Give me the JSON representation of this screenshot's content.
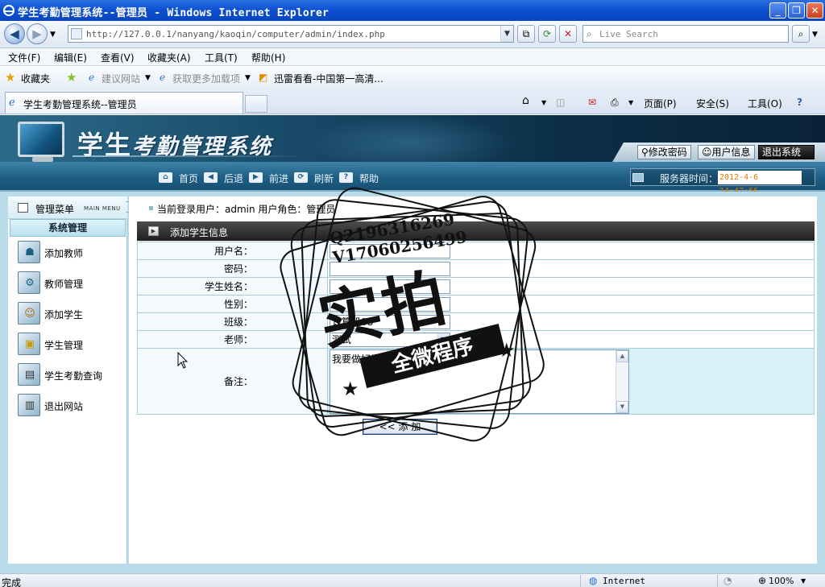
{
  "browser": {
    "window_title": "学生考勤管理系统--管理员 - Windows Internet Explorer",
    "url": "http://127.0.0.1/nanyang/kaoqin/computer/admin/index.php",
    "search_placeholder": "Live Search",
    "menu": [
      "文件(F)",
      "编辑(E)",
      "查看(V)",
      "收藏夹(A)",
      "工具(T)",
      "帮助(H)"
    ],
    "favorites": {
      "label": "收藏夹",
      "links": [
        "建议网站",
        "获取更多加载项",
        "迅雷看看-中国第一高清..."
      ]
    },
    "tab_title": "学生考勤管理系统--管理员",
    "commands": [
      "页面(P)",
      "安全(S)",
      "工具(O)"
    ],
    "status_text": "完成",
    "zone": "Internet",
    "zoom": "100%"
  },
  "app": {
    "title_part1": "学生",
    "title_part2": "考勤管理系统",
    "top_buttons": [
      "修改密码",
      "用户信息",
      "退出系统"
    ],
    "nav": [
      "首页",
      "后退",
      "前进",
      "刷新",
      "帮助"
    ],
    "server_time_label": "服务器时间：",
    "server_time": "2012-4-6 14:47:56"
  },
  "sidebar": {
    "title": "管理菜单",
    "subtitle": "MAIN MENU",
    "group": "系统管理",
    "items": [
      {
        "label": "添加教师",
        "icon": "add-teacher-icon"
      },
      {
        "label": "教师管理",
        "icon": "gear-icon"
      },
      {
        "label": "添加学生",
        "icon": "add-student-icon"
      },
      {
        "label": "学生管理",
        "icon": "lock-icon"
      },
      {
        "label": "学生考勤查询",
        "icon": "query-icon"
      },
      {
        "label": "退出网站",
        "icon": "exit-icon"
      }
    ]
  },
  "main": {
    "login_info": "当前登录用户：admin  用户角色：管理员",
    "form_title": "添加学生信息",
    "fields": {
      "username_label": "用户名：",
      "password_label": "密码：",
      "name_label": "学生姓名：",
      "gender_label": "性别：",
      "class_label": "班级：",
      "class_value": "计算机08",
      "teacher_label": "老师：",
      "teacher_value": "测试",
      "remark_label": "备注：",
      "remark_value": "我要做好学生"
    },
    "submit_label": "<< 添 加"
  },
  "watermark": {
    "line1": "Q2196316269",
    "line2": "V17060256499",
    "big": "实拍",
    "ribbon": "全微程序"
  }
}
